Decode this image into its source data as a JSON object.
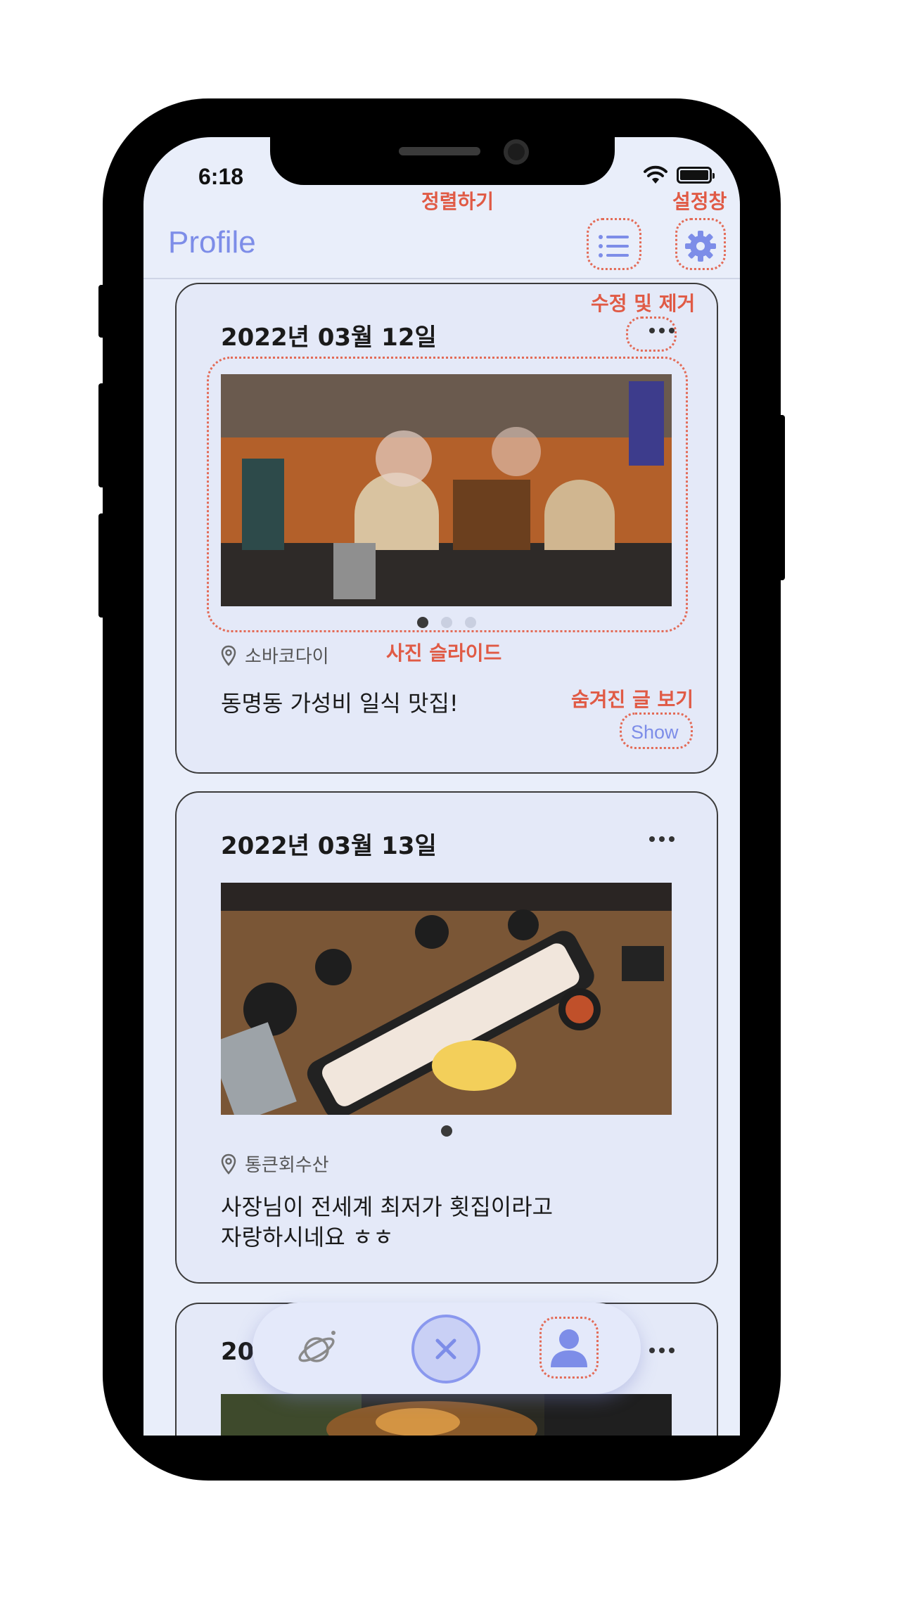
{
  "status_bar": {
    "time": "6:18"
  },
  "nav": {
    "title": "Profile"
  },
  "annotations": {
    "sort": "정렬하기",
    "settings": "설정창",
    "edit_delete": "수정 및 제거",
    "photo_slide": "사진 슬라이드",
    "show_hidden": "숨겨진 글 보기"
  },
  "posts": [
    {
      "date": "2022년 03월 12일",
      "location": "소바코다이",
      "text": "동명동 가성비 일식 맛집!",
      "show_label": "Show",
      "photo_count": 3,
      "active_photo": 1,
      "photo_subject": "cafe interior with dried flower ceiling"
    },
    {
      "date": "2022년 03월 13일",
      "location": "통큰회수산",
      "text_line1": "사장님이 전세계 최저가 횟집이라고",
      "text_line2": "자랑하시네요 ㅎㅎ",
      "photo_count": 1,
      "active_photo": 1,
      "photo_subject": "sashimi platter with side dishes on wooden table"
    },
    {
      "date_partial": "20"
    }
  ],
  "tab_bar": {
    "items": [
      {
        "icon": "planet-icon",
        "selected": false
      },
      {
        "icon": "close-icon",
        "selected": false
      },
      {
        "icon": "person-icon",
        "selected": true
      }
    ]
  },
  "colors": {
    "accent": "#7d8de8",
    "annotation": "#e05a45",
    "background": "#e9eefa",
    "card": "#e4e9f8"
  }
}
